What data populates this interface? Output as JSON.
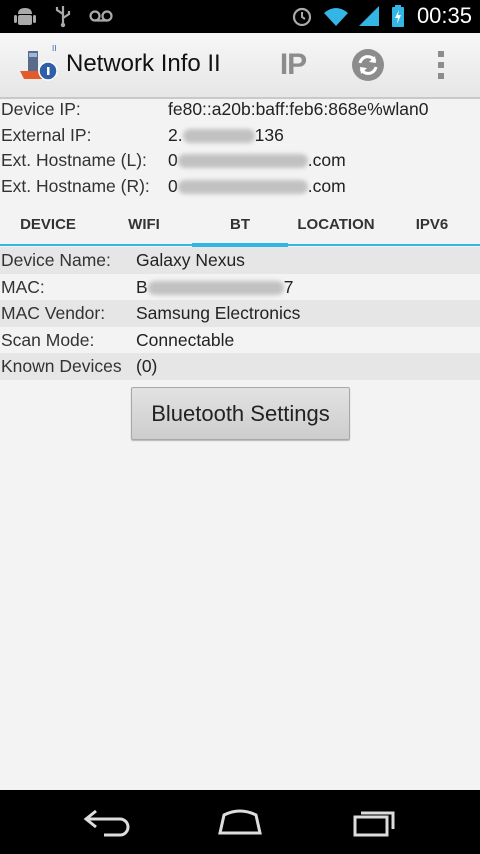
{
  "status_bar": {
    "left_icons": [
      "android-debug-icon",
      "usb-icon",
      "voicemail-icon"
    ],
    "right_icons": [
      "alarm-icon",
      "wifi-icon",
      "signal-icon",
      "battery-charging-icon"
    ],
    "time": "00:35"
  },
  "action_bar": {
    "title": "Network Info II",
    "ip_label": "IP",
    "icons": [
      "app-logo-icon",
      "refresh-icon",
      "overflow-menu-icon"
    ]
  },
  "info": [
    {
      "label": "Device IP:",
      "value": "fe80::a20b:baff:feb6:868e%wlan0"
    },
    {
      "label": "External IP:",
      "value_prefix": "2.",
      "value_suffix": "136"
    },
    {
      "label": "Ext. Hostname (L):",
      "value_prefix": "0",
      "value_suffix": ".com"
    },
    {
      "label": "Ext. Hostname (R):",
      "value_prefix": "0",
      "value_suffix": ".com"
    }
  ],
  "tabs": [
    {
      "label": "DEVICE"
    },
    {
      "label": "WIFI"
    },
    {
      "label": "BT",
      "selected": true
    },
    {
      "label": "LOCATION"
    },
    {
      "label": "IPV6"
    }
  ],
  "bt": [
    {
      "label": "Device Name:",
      "value": "Galaxy Nexus"
    },
    {
      "label": "MAC:",
      "value_prefix": "B",
      "value_suffix": "7"
    },
    {
      "label": "MAC Vendor:",
      "value": "Samsung Electronics"
    },
    {
      "label": "Scan Mode:",
      "value": "Connectable"
    },
    {
      "label": "Known Devices",
      "value": "(0)"
    }
  ],
  "button": {
    "label": "Bluetooth Settings"
  },
  "colors": {
    "accent": "#33b5e5",
    "status_bar": "#000000",
    "nav_bar": "#000000"
  },
  "nav_bar": {
    "icons": [
      "back-icon",
      "home-icon",
      "recent-apps-icon"
    ]
  }
}
